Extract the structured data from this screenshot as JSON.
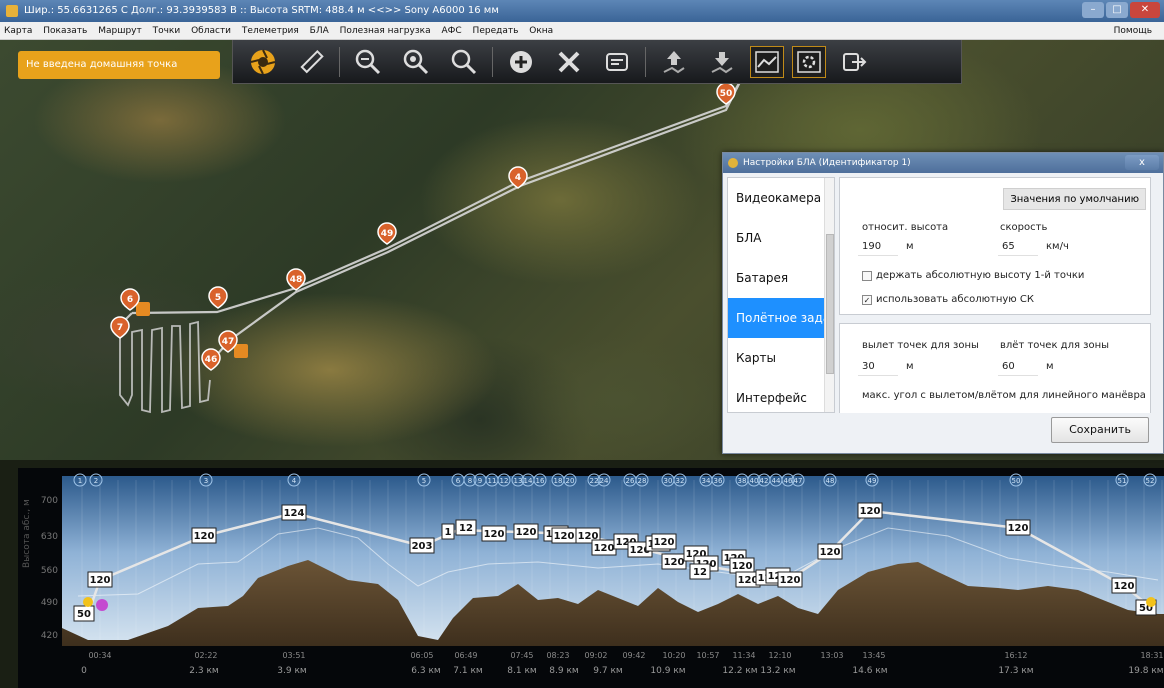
{
  "window": {
    "title": "Шир.: 55.6631265 С   Долг.: 93.3939583 В   ::   Высота SRTM: 488.4 м   <<>>   Sony A6000 16 мм",
    "buttons": {
      "minimize": "–",
      "maximize": "□",
      "close": "✕"
    }
  },
  "menu": {
    "items": [
      "Карта",
      "Показать",
      "Маршрут",
      "Точки",
      "Области",
      "Телеметрия",
      "БЛА",
      "Полезная нагрузка",
      "АФС",
      "Передать",
      "Окна"
    ],
    "help": "Помощь"
  },
  "toolbar": {
    "icons": [
      "aperture-icon",
      "ruler-icon",
      "zoom-out-icon",
      "zoom-area-icon",
      "zoom-in-icon",
      "add-point-icon",
      "tools-icon",
      "card-icon",
      "upload-route-icon",
      "download-route-icon",
      "profile-toggle-icon",
      "settings-toggle-icon",
      "export-icon"
    ],
    "accent": "#c08a18"
  },
  "map": {
    "home_warning": "Не введена домашняя точка",
    "waypoints": [
      {
        "label": "50"
      },
      {
        "label": "4"
      },
      {
        "label": "49"
      },
      {
        "label": "48"
      },
      {
        "label": "5"
      },
      {
        "label": "6"
      },
      {
        "label": "7"
      },
      {
        "label": "47"
      },
      {
        "label": "46"
      }
    ],
    "marker_color": "#d9622b"
  },
  "dialog": {
    "title": "Настройки БЛА (Идентификатор 1)",
    "close": "x",
    "nav": [
      "Видеокамера",
      "БЛА",
      "Батарея",
      "Полётное задание",
      "Карты",
      "Интерфейс"
    ],
    "selected_nav": "Полётное задание",
    "defaults_button": "Значения по умолчанию",
    "rel_altitude_label": "относит. высота",
    "rel_altitude_value": "190",
    "rel_altitude_unit": "м",
    "speed_label": "скорость",
    "speed_value": "65",
    "speed_unit": "км/ч",
    "hold_abs_alt": "держать абсолютную высоту 1-й точки",
    "hold_abs_alt_checked": false,
    "use_abs_cs": "использовать абсолютную СК",
    "use_abs_cs_checked": true,
    "zone_exit_label": "вылет точек для зоны",
    "zone_exit_value": "30",
    "zone_exit_unit": "м",
    "zone_entry_label": "влёт точек для зоны",
    "zone_entry_value": "60",
    "zone_entry_unit": "м",
    "max_angle_label": "макс. угол с вылетом/влётом для линейного манёвра",
    "save_button": "Сохранить"
  },
  "profile": {
    "y_axis_label": "Высота абс., м",
    "y_ticks": [
      "700",
      "630",
      "560",
      "490",
      "420"
    ],
    "waypoint_tags": [
      "1",
      "2",
      "3",
      "4",
      "5",
      "6",
      "8",
      "9",
      "11",
      "12",
      "13",
      "14",
      "16",
      "18",
      "20",
      "22",
      "24",
      "26",
      "28",
      "30",
      "32",
      "34",
      "36",
      "38",
      "40",
      "42",
      "44",
      "46",
      "47",
      "48",
      "49",
      "50",
      "51",
      "52"
    ],
    "altitude_labels": [
      "50",
      "120",
      "120",
      "124",
      "203",
      "1",
      "12",
      "120",
      "120",
      "120",
      "120",
      "120",
      "120",
      "120",
      "120",
      "120",
      "120",
      "120",
      "120",
      "120",
      "12",
      "120",
      "120",
      "120",
      "120",
      "120",
      "120",
      "120",
      "50"
    ],
    "time_ticks": [
      "00:34",
      "02:22",
      "03:51",
      "06:05",
      "06:49",
      "07:45",
      "08:23",
      "09:02",
      "09:42",
      "10:20",
      "10:57",
      "11:34",
      "12:10",
      "13:03",
      "13:45",
      "16:12",
      "18:31"
    ],
    "dist_ticks": [
      "0",
      "2.3 км",
      "3.9 км",
      "6.3 км",
      "7.1 км",
      "8.1 км",
      "8.9 км",
      "9.7 км",
      "10.9 км",
      "12.2 км",
      "13.2 км",
      "14.6 км",
      "17.3 км",
      "19.8 км"
    ]
  }
}
